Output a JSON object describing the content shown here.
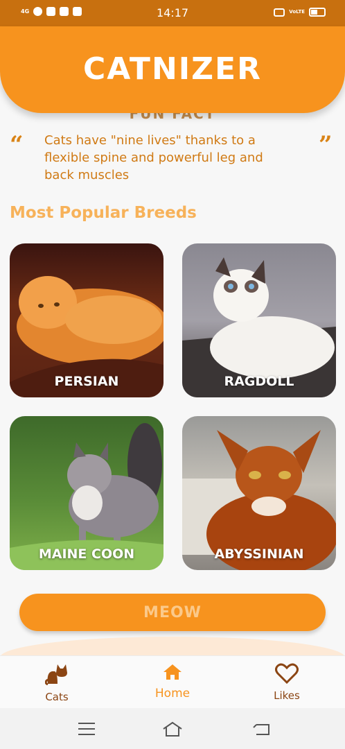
{
  "status_bar": {
    "network": "4G",
    "time": "14:17",
    "volte": "VoLTE",
    "battery": "51"
  },
  "app": {
    "logo_text": "CATNIZER"
  },
  "fun_fact": {
    "title": "FUN FACT",
    "text": "Cats have \"nine lives\" thanks to a flexible spine and powerful leg and back muscles"
  },
  "breeds": {
    "section_title": "Most Popular Breeds",
    "items": [
      {
        "label": "PERSIAN"
      },
      {
        "label": "RAGDOLL"
      },
      {
        "label": "MAINE COON"
      },
      {
        "label": "ABYSSINIAN"
      }
    ]
  },
  "actions": {
    "meow_label": "MEOW"
  },
  "bottom_nav": {
    "items": [
      {
        "label": "Cats",
        "icon": "cat-icon"
      },
      {
        "label": "Home",
        "icon": "home-icon",
        "active": true
      },
      {
        "label": "Likes",
        "icon": "heart-icon"
      }
    ]
  },
  "colors": {
    "brand_orange": "#f7931e",
    "status_bar": "#c8700f",
    "inactive_nav": "#8b4513"
  }
}
